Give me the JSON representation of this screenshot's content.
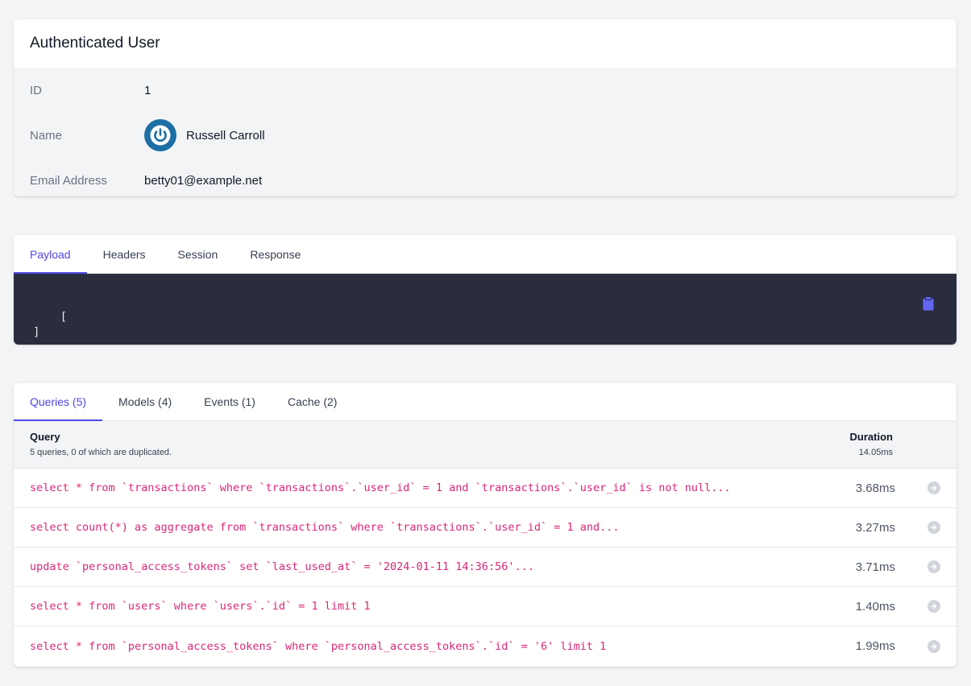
{
  "user": {
    "title": "Authenticated User",
    "fields": [
      {
        "label": "ID",
        "value": "1"
      },
      {
        "label": "Name",
        "value": "Russell Carroll"
      },
      {
        "label": "Email Address",
        "value": "betty01@example.net"
      }
    ]
  },
  "request": {
    "tabs": [
      "Payload",
      "Headers",
      "Session",
      "Response"
    ],
    "active_tab": "Payload",
    "payload": "[\n]"
  },
  "queries": {
    "tabs": [
      "Queries (5)",
      "Models (4)",
      "Events (1)",
      "Cache (2)"
    ],
    "active_tab": "Queries (5)",
    "header": {
      "query_label": "Query",
      "summary": "5 queries, 0 of which are duplicated.",
      "duration_label": "Duration",
      "total": "14.05ms"
    },
    "rows": [
      {
        "sql": "select * from `transactions` where `transactions`.`user_id` = 1 and `transactions`.`user_id` is not null...",
        "duration": "3.68ms"
      },
      {
        "sql": "select count(*) as aggregate from `transactions` where `transactions`.`user_id` = 1 and...",
        "duration": "3.27ms"
      },
      {
        "sql": "update `personal_access_tokens` set `last_used_at` = '2024-01-11 14:36:56'...",
        "duration": "3.71ms"
      },
      {
        "sql": "select * from `users` where `users`.`id` = 1 limit 1",
        "duration": "1.40ms"
      },
      {
        "sql": "select * from `personal_access_tokens` where `personal_access_tokens`.`id` = '6' limit 1",
        "duration": "1.99ms"
      }
    ]
  },
  "colors": {
    "accent": "#4f46e5",
    "sql": "#db2777",
    "code_bg": "#292d3e",
    "avatar": "#1d6fa5"
  }
}
